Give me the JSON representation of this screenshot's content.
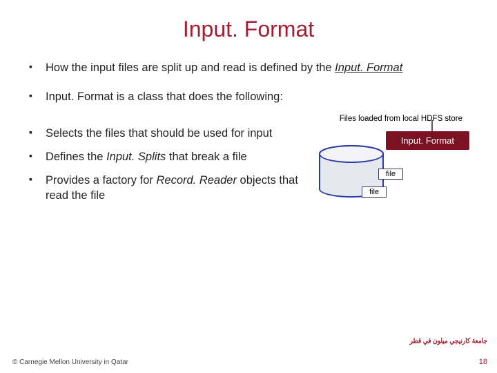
{
  "title": "Input. Format",
  "bullets": {
    "b1_pre": "How the input files are split up and read is defined by the ",
    "b1_kw": "Input. Format",
    "b2": "Input. Format is a class that does the following:",
    "b3": "Selects the files that should be used for input",
    "b4_pre": "Defines the ",
    "b4_kw": "Input. Splits",
    "b4_post": " that break a file",
    "b5_pre": "Provides a factory for ",
    "b5_kw": "Record. Reader",
    "b5_post": " objects that read the file"
  },
  "files_label": "Files loaded from local HDFS store",
  "badge": "Input. Format",
  "filebox": "file",
  "footer": {
    "copyright": "© Carnegie Mellon University in Qatar",
    "page": "18"
  },
  "logo": {
    "line1": "جامعة كارنيجي ميلون في قطر",
    "line2": ""
  }
}
